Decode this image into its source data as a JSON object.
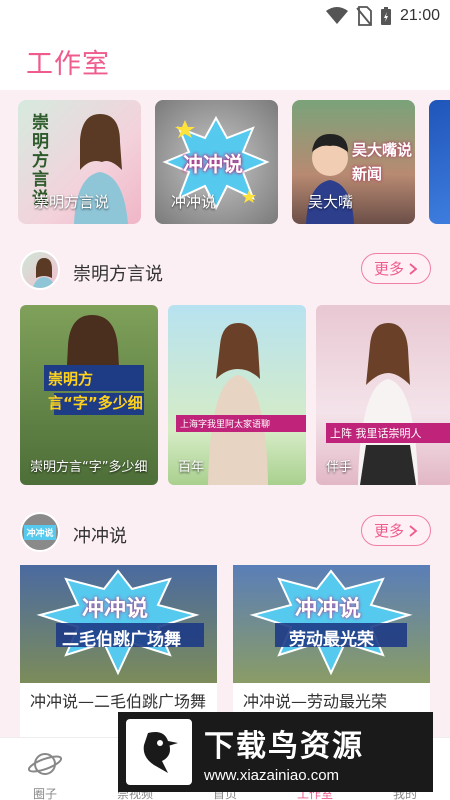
{
  "status": {
    "time": "21:00"
  },
  "header": {
    "title": "工作室"
  },
  "top_cards": [
    {
      "label": "崇明方言说",
      "art_text": "崇明方言说"
    },
    {
      "label": "冲冲说",
      "art_text": "冲冲说"
    },
    {
      "label": "吴大嘴",
      "art_text": "吴大嘴说新闻"
    },
    {
      "label": "",
      "art_text": ""
    }
  ],
  "section1": {
    "title": "崇明方言说",
    "more": "更多",
    "videos": [
      {
        "label": "崇明方言“字”多少细",
        "art_text": "崇明方言“字”多少细"
      },
      {
        "label": "百年",
        "art_text": "上海字我里阿太家语聊"
      },
      {
        "label": "伴手",
        "art_text": "上阵 我里话崇明人"
      }
    ]
  },
  "section2": {
    "title": "冲冲说",
    "more": "更多",
    "avatar_text": "冲冲说",
    "videos": [
      {
        "caption": "冲冲说—二毛伯跳广场舞",
        "art_title": "冲冲说",
        "art_sub": "二毛伯跳广场舞"
      },
      {
        "caption": "冲冲说—劳动最光荣",
        "art_title": "冲冲说",
        "art_sub": "劳动最光荣"
      }
    ]
  },
  "nav": {
    "items": [
      {
        "label": "圈子",
        "icon": "planet-icon"
      },
      {
        "label": "崇视频",
        "icon": "video-icon"
      },
      {
        "label": "首页",
        "icon": "home-icon"
      },
      {
        "label": "工作室",
        "icon": "studio-icon"
      },
      {
        "label": "我的",
        "icon": "user-icon"
      }
    ],
    "active_index": 3
  },
  "watermark": {
    "title": "下载鸟资源",
    "url": "www.xiazainiao.com"
  },
  "colors": {
    "accent": "#ef5b8c",
    "background": "#fbeff4"
  }
}
